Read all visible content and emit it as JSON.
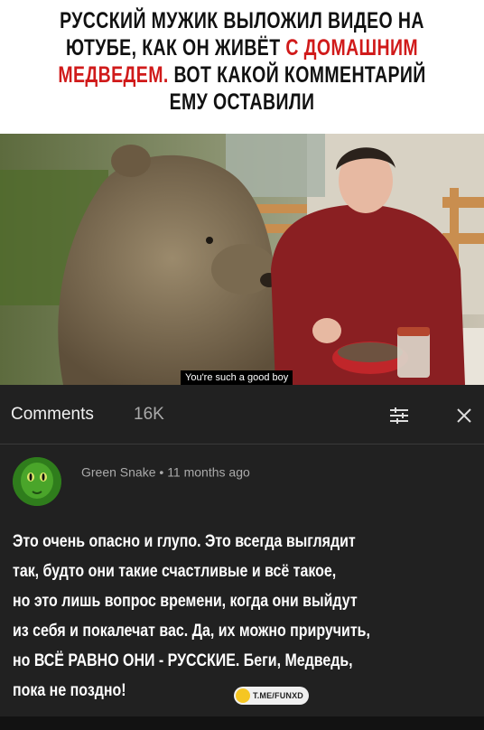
{
  "headline": {
    "line1": "РУССКИЙ МУЖИК ВЫЛОЖИЛ ВИДЕО НА",
    "line2_a": "ЮТУБЕ, КАК ОН ЖИВЁТ ",
    "line2_b": "С ДОМАШНИМ",
    "line3_a": "МЕДВЕДЕМ.",
    "line3_b": " ВОТ КАКОЙ КОММЕНТАРИЙ",
    "line4": "ЕМУ ОСТАВИЛИ",
    "highlight_color": "#d01a1a"
  },
  "video": {
    "subtitle": "You're such a good boy"
  },
  "comments": {
    "title": "Comments",
    "count": "16K",
    "sort_icon": "sort-icon",
    "close_icon": "close-icon",
    "item": {
      "author": "Green Snake",
      "separator": "•",
      "time": "11 months ago",
      "lines": [
        "Это очень опасно и глупо. Это всегда выглядит",
        "так, будто они такие счастливые и всё такое,",
        "но это лишь вопрос времени, когда они выйдут",
        "из себя и покалечат вас. Да, их можно приручить,",
        "но ВСЁ РАВНО ОНИ - РУССКИЕ. Беги, Медведь,",
        "пока не поздно!"
      ]
    }
  },
  "watermark": {
    "text": "T.ME/FUNXD"
  }
}
